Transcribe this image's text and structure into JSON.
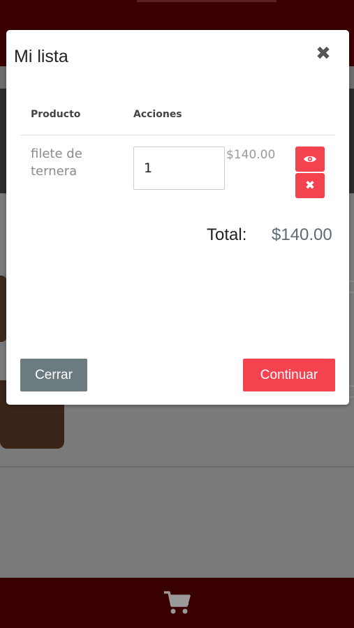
{
  "modal": {
    "title": "Mi lista",
    "close_glyph": "✖",
    "table": {
      "headers": [
        "Producto",
        "Acciones"
      ],
      "rows": [
        {
          "product": "filete de ternera",
          "quantity": "1",
          "price": "$140.00",
          "view_icon": "eye-icon",
          "remove_glyph": "✖"
        }
      ]
    },
    "total_label": "Total:",
    "total_value": "$140.00",
    "buttons": {
      "close": "Cerrar",
      "continue": "Continuar"
    }
  },
  "footer": {
    "cart_icon": "shopping-cart-icon"
  },
  "colors": {
    "accent": "#f5424f",
    "secondary": "#6b7b80",
    "header": "#3a0000"
  }
}
